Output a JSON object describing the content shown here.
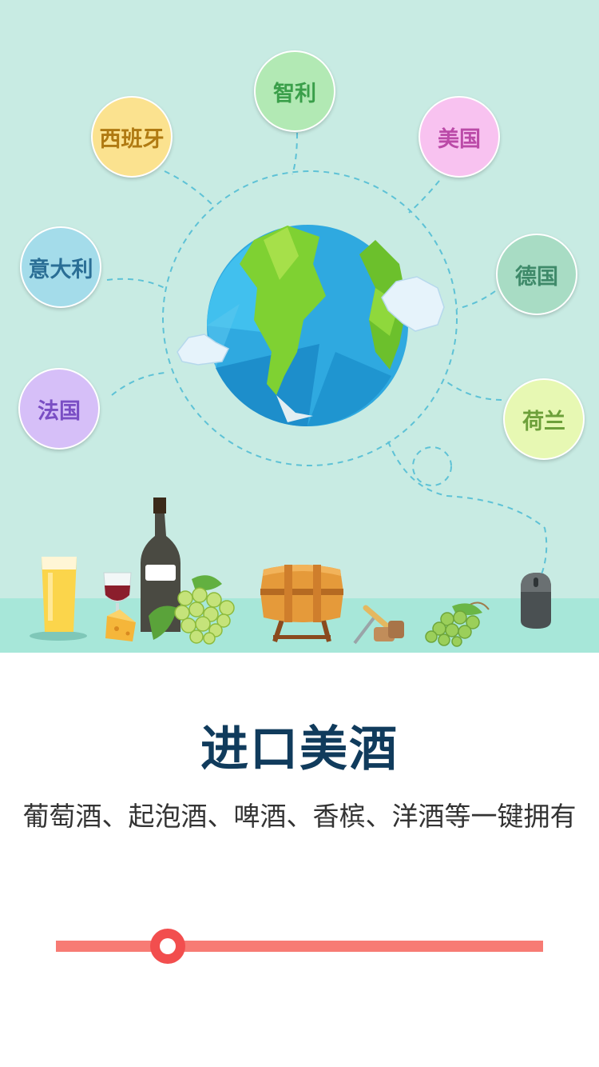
{
  "countries": {
    "spain": {
      "label": "西班牙",
      "bg": "#fbe28f",
      "color": "#b07a12"
    },
    "chile": {
      "label": "智利",
      "bg": "#b2e9b4",
      "color": "#3a9f4a"
    },
    "usa": {
      "label": "美国",
      "bg": "#f8c2f0",
      "color": "#bb4aa8"
    },
    "italy": {
      "label": "意大利",
      "bg": "#a4dcea",
      "color": "#2a6e95"
    },
    "germany": {
      "label": "德国",
      "bg": "#a8dcc4",
      "color": "#3f8a6a"
    },
    "france": {
      "label": "法国",
      "bg": "#d6bff8",
      "color": "#7a4ec4"
    },
    "netherlands": {
      "label": "荷兰",
      "bg": "#e7f8b3",
      "color": "#6da03a"
    }
  },
  "main": {
    "title": "进口美酒",
    "subtitle": "葡萄酒、起泡酒、啤酒、香槟、洋酒等一键拥有"
  },
  "slider": {
    "value_percent": 23,
    "track_color": "#f77b74",
    "knob_color": "#f24e4e"
  }
}
